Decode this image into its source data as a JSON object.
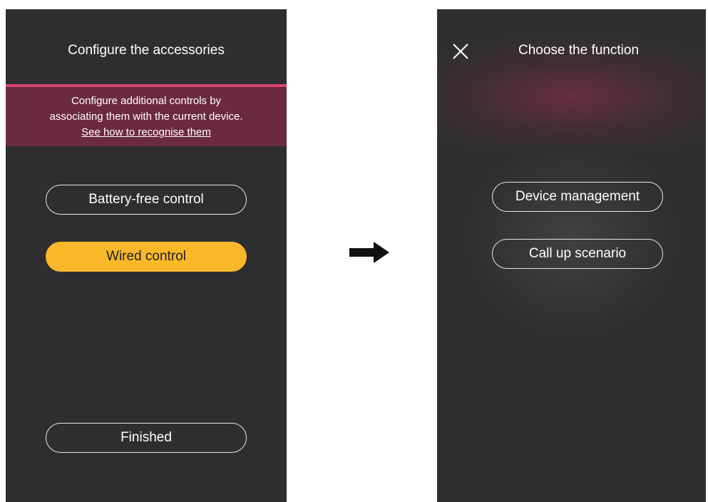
{
  "left_screen": {
    "title": "Configure the accessories",
    "banner": {
      "line1": "Configure additional controls by",
      "line2": "associating them with the current device.",
      "link": "See how to recognise them"
    },
    "buttons": {
      "battery_free": "Battery-free control",
      "wired": "Wired control",
      "finished": "Finished"
    }
  },
  "right_screen": {
    "title": "Choose the function",
    "buttons": {
      "device_management": "Device management",
      "call_up_scenario": "Call up scenario"
    }
  },
  "icons": {
    "close": "close-icon",
    "arrow": "arrow-right-icon"
  },
  "colors": {
    "screen_bg": "#2e2e30",
    "accent_line": "#d8446e",
    "banner_bg": "#6c2a40",
    "selected_button": "#f8b82a"
  }
}
